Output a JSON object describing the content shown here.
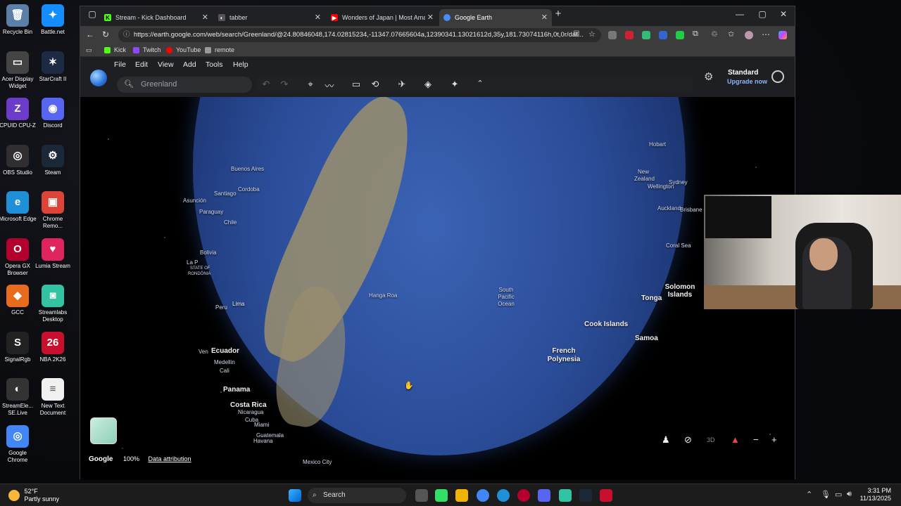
{
  "desktop_icons": [
    {
      "label": "Recycle Bin",
      "color": "#5b7fa6",
      "glyph": "🗑"
    },
    {
      "label": "Battle.net",
      "color": "#148eff",
      "glyph": "✦"
    },
    {
      "label": "Acer Display Widget",
      "color": "#444",
      "glyph": "▭"
    },
    {
      "label": "StarCraft II",
      "color": "#1c2a44",
      "glyph": "✶"
    },
    {
      "label": "CPUID CPU-Z",
      "color": "#6a3cc9",
      "glyph": "Z"
    },
    {
      "label": "Discord",
      "color": "#5865f2",
      "glyph": "◉"
    },
    {
      "label": "OBS Studio",
      "color": "#302e31",
      "glyph": "◎"
    },
    {
      "label": "Steam",
      "color": "#1b2838",
      "glyph": "⚙"
    },
    {
      "label": "Microsoft Edge",
      "color": "#1f8fd8",
      "glyph": "e"
    },
    {
      "label": "Chrome Remo...",
      "color": "#db4437",
      "glyph": "▣"
    },
    {
      "label": "Opera GX Browser",
      "color": "#b3002d",
      "glyph": "O"
    },
    {
      "label": "Lumia Stream",
      "color": "#e0245e",
      "glyph": "♥"
    },
    {
      "label": "GCC",
      "color": "#e86a1c",
      "glyph": "◆"
    },
    {
      "label": "Streamlabs Desktop",
      "color": "#31c3a2",
      "glyph": "◙"
    },
    {
      "label": "SignalRgb",
      "color": "#222",
      "glyph": "S"
    },
    {
      "label": "NBA 2K26",
      "color": "#c8102e",
      "glyph": "26"
    },
    {
      "label": "StreamEle... SE.Live",
      "color": "#333",
      "glyph": "◐"
    },
    {
      "label": "New Text Document",
      "color": "#f0f0f0",
      "glyph": "≡"
    },
    {
      "label": "Google Chrome",
      "color": "#4285f4",
      "glyph": "◎"
    }
  ],
  "tabs": [
    {
      "title": "Stream - Kick Dashboard",
      "fav_color": "#53fc18",
      "fav_glyph": "K"
    },
    {
      "title": "tabber",
      "fav_color": "#555",
      "fav_glyph": "◐"
    },
    {
      "title": "Wonders of Japan | Most Amazin...",
      "fav_color": "#ff0000",
      "fav_glyph": "▶"
    },
    {
      "title": "Google Earth",
      "fav_color": "#4a8bf5",
      "fav_glyph": "●"
    }
  ],
  "address": {
    "url": "https://earth.google.com/web/search/Greenland/@24.80846048,174.02815234,-11347.07665604a,12390341.13021612d,35y,181.73074116h,0t,0r/dat..."
  },
  "favorites": [
    {
      "label": "Kick",
      "color": "#53fc18"
    },
    {
      "label": "Twitch",
      "color": "#9146ff"
    },
    {
      "label": "YouTube",
      "color": "#ff0000"
    },
    {
      "label": "remote",
      "color": "#999"
    }
  ],
  "earth": {
    "menu": [
      "File",
      "Edit",
      "View",
      "Add",
      "Tools",
      "Help"
    ],
    "search_value": "Greenland",
    "plan_name": "Standard",
    "upgrade_label": "Upgrade now",
    "footer_brand": "Google",
    "footer_zoom": "100%",
    "footer_link": "Data attribution",
    "labels": {
      "buenos_aires": "Buenos Aires",
      "cordoba": "Cordoba",
      "santiago": "Santiago",
      "asuncion": "Asunción",
      "paraguay": "Paraguay",
      "chile": "Chile",
      "bolivia": "Bolivia",
      "la_paz": "La P",
      "state_of": "STATE OF",
      "rondonia": "RONDÔNIA",
      "lima": "Lima",
      "peru": "Peru",
      "ecuador": "Ecuador",
      "medellin": "Medellin",
      "cali": "Cali",
      "venezuela": "Ven",
      "panama": "Panama",
      "costa_rica": "Costa Rica",
      "nicaragua": "Nicaragua",
      "cuba": "Cuba",
      "miami": "Miami",
      "guatemala": "Guatemala",
      "havana": "Havana",
      "mexico_city": "Mexico City",
      "hanga_roa": "Hanga Roa",
      "south_pacific_ocean": "South Pacific Ocean",
      "hobart": "Hobart",
      "new_zealand": "New Zealand",
      "wellington": "Wellington",
      "sydney": "Sydney",
      "auckland": "Auckland",
      "brisbane": "Brisbane",
      "coral_sea": "Coral Sea",
      "solomon_islands": "Solomon Islands",
      "tonga": "Tonga",
      "cook_islands": "Cook Islands",
      "samoa": "Samoa",
      "french_polynesia": "French Polynesia"
    }
  },
  "taskbar": {
    "temperature": "52°F",
    "weather": "Partly sunny",
    "search_placeholder": "Search",
    "time": "3:31 PM",
    "date": "11/13/2025"
  }
}
